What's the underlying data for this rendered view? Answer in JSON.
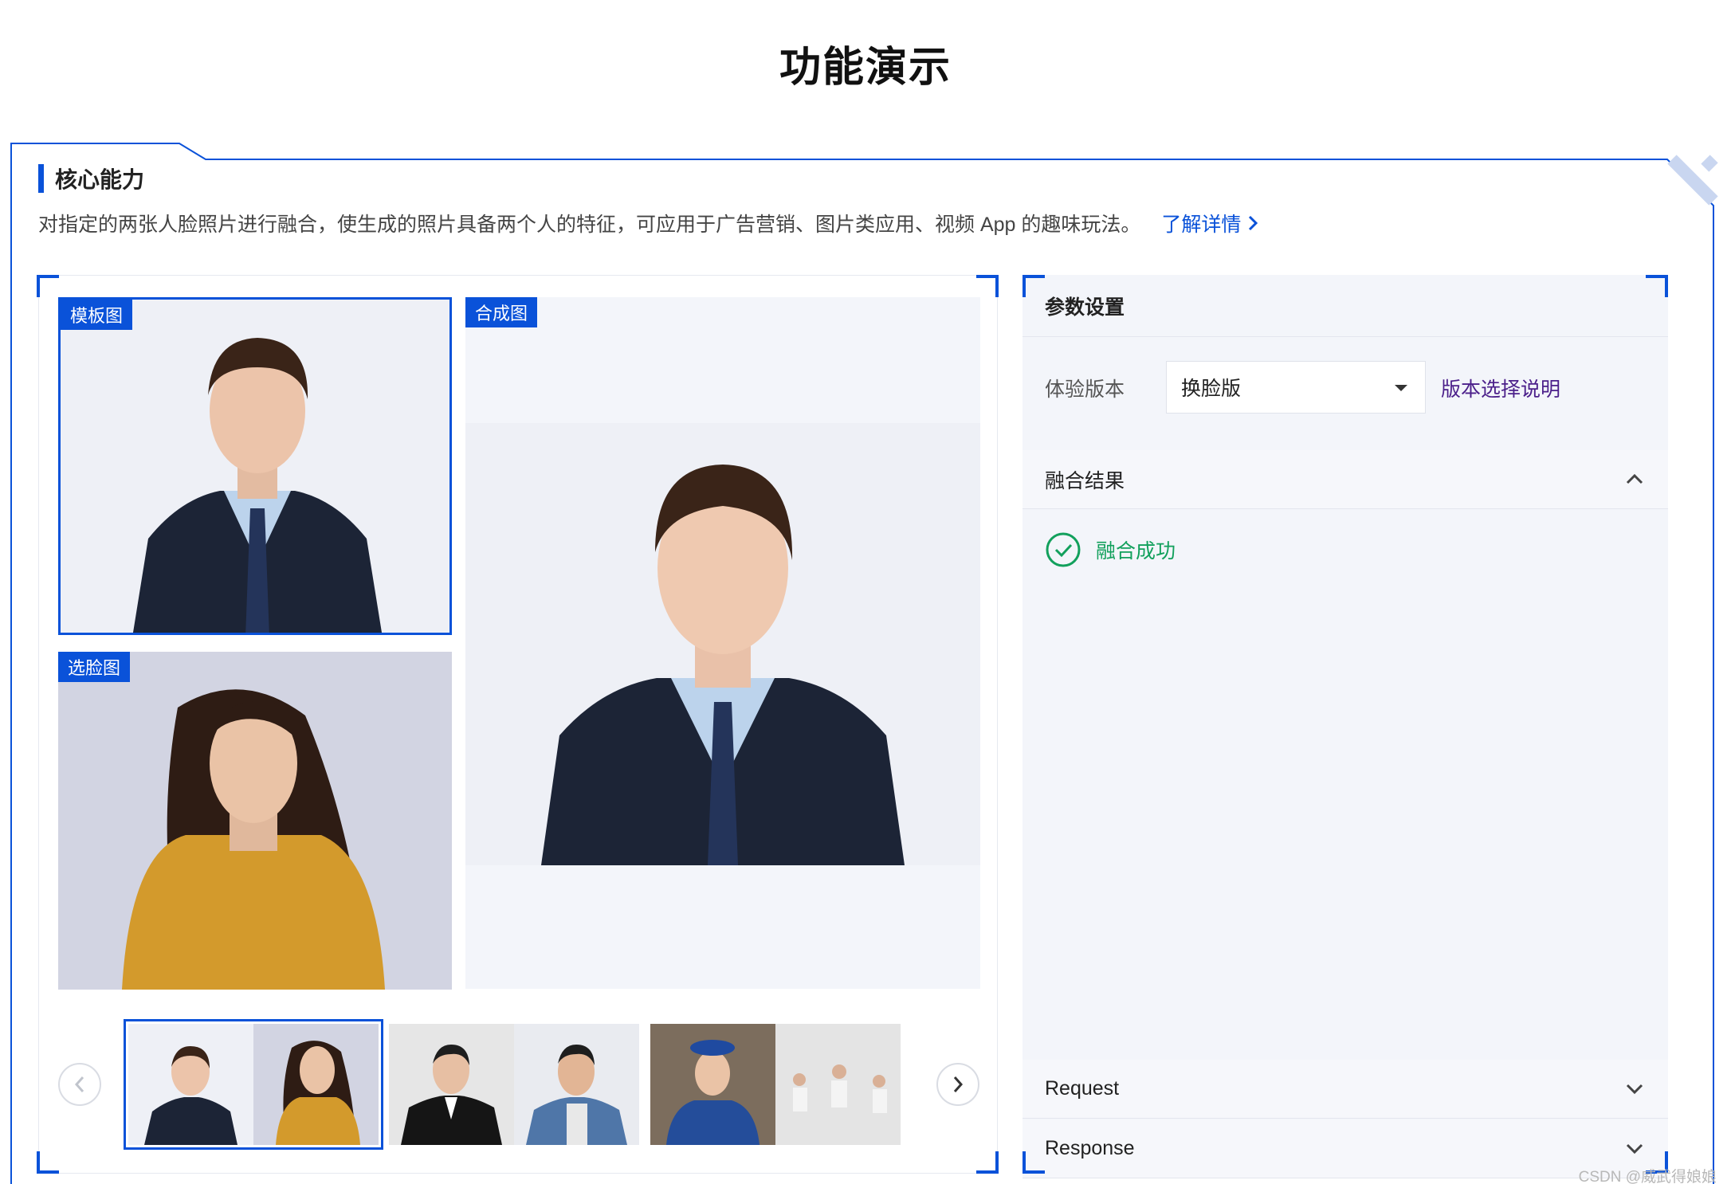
{
  "page": {
    "title": "功能演示"
  },
  "section": {
    "title": "核心能力",
    "description": "对指定的两张人脸照片进行融合，使生成的照片具备两个人的特征，可应用于广告营销、图片类应用、视频 App 的趣味玩法。",
    "more_link": "了解详情"
  },
  "demo": {
    "template_tag": "模板图",
    "face_tag": "选脸图",
    "result_tag": "合成图"
  },
  "settings": {
    "title": "参数设置",
    "version_label": "体验版本",
    "version_value": "换脸版",
    "version_help": "版本选择说明",
    "result_section": "融合结果",
    "result_status": "融合成功",
    "request_label": "Request",
    "response_label": "Response"
  },
  "colors": {
    "accent": "#0a52d9",
    "success": "#12a05c",
    "link_purple": "#4b1f8a"
  },
  "watermark": "CSDN @威武得娘娘"
}
